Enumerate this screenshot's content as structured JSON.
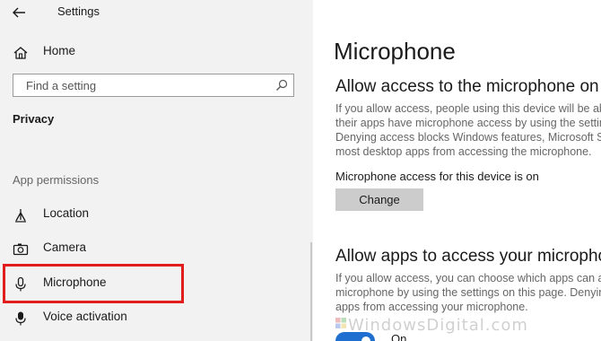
{
  "window": {
    "title": "Settings"
  },
  "sidebar": {
    "home_label": "Home",
    "search_placeholder": "Find a setting",
    "section_label": "Privacy",
    "group_label": "App permissions",
    "items": [
      {
        "label": "Location",
        "icon": "location-icon"
      },
      {
        "label": "Camera",
        "icon": "camera-icon"
      },
      {
        "label": "Microphone",
        "icon": "microphone-icon",
        "highlighted": true
      },
      {
        "label": "Voice activation",
        "icon": "voice-activation-icon"
      }
    ]
  },
  "main": {
    "page_title": "Microphone",
    "section1": {
      "heading": "Allow access to the microphone on this device",
      "lines": [
        "If you allow access, people using this device will be able to choose whether",
        "their apps have microphone access by using the settings on this page.",
        "Denying access blocks Windows features, Microsoft Store apps and",
        "most desktop apps from accessing the microphone."
      ],
      "status": "Microphone access for this device is on",
      "button_label": "Change"
    },
    "section2": {
      "heading": "Allow apps to access your microphone",
      "lines": [
        "If you allow access, you can choose which apps can access your",
        "microphone by using the settings on this page. Denying access blocks",
        "apps from accessing your microphone."
      ],
      "toggle_label": "On",
      "toggle_on": true
    }
  },
  "watermark": "WindowsDigital.com",
  "colors": {
    "highlight": "#e11d1d",
    "toggle_on": "#1f6fd0",
    "sidebar_bg": "#f2f2f2"
  }
}
